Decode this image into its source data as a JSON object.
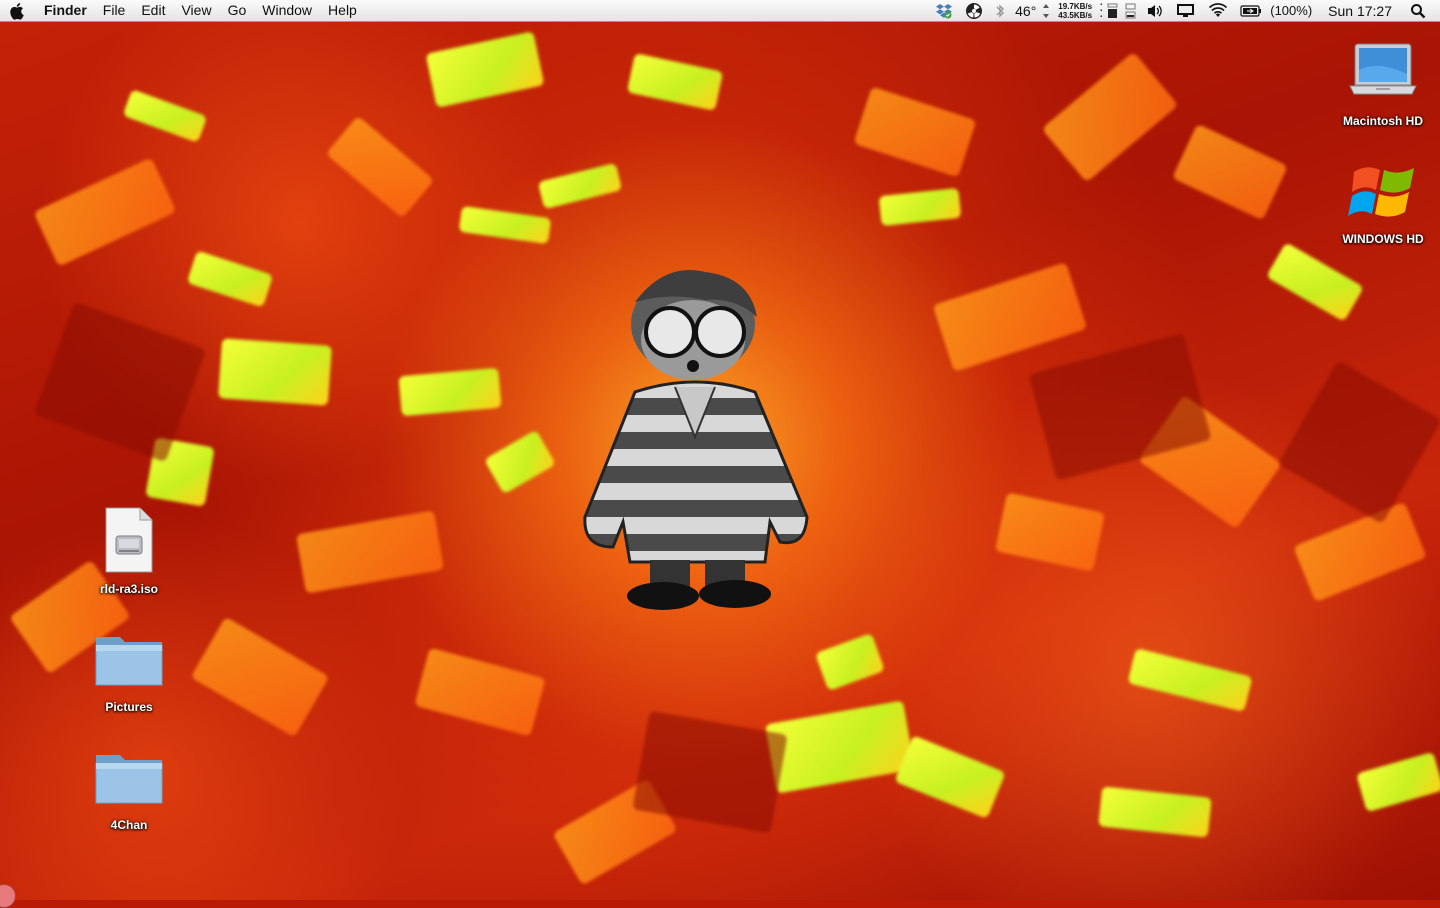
{
  "menubar": {
    "app_name": "Finder",
    "items": [
      "File",
      "Edit",
      "View",
      "Go",
      "Window",
      "Help"
    ],
    "temperature": "46°",
    "net_up": "19.7KB/s",
    "net_down": "43.5KB/s",
    "battery": "(100%)",
    "clock": "Sun 17:27",
    "icons": [
      "dropbox-icon",
      "radiation-icon",
      "bluetooth-icon",
      "weather-arrows-icon",
      "disk-activity-icon",
      "memory-icon",
      "volume-icon",
      "display-icon",
      "wifi-icon",
      "battery-icon",
      "spotlight-icon"
    ]
  },
  "desktop": {
    "right_icons": [
      {
        "label": "Macintosh HD",
        "icon": "macbook-drive-icon"
      },
      {
        "label": "WINDOWS HD",
        "icon": "windows-logo-icon"
      }
    ],
    "left_icons": [
      {
        "label": "rld-ra3.iso",
        "icon": "disk-image-icon"
      },
      {
        "label": "Pictures",
        "icon": "folder-icon"
      },
      {
        "label": "4Chan",
        "icon": "folder-icon"
      }
    ]
  },
  "colors": {
    "wallpaper_base": "#b81a06",
    "shard_yellow": "#e8ff2a",
    "shard_orange": "#ff8a1a",
    "folder_blue": "#8fb9dc"
  }
}
